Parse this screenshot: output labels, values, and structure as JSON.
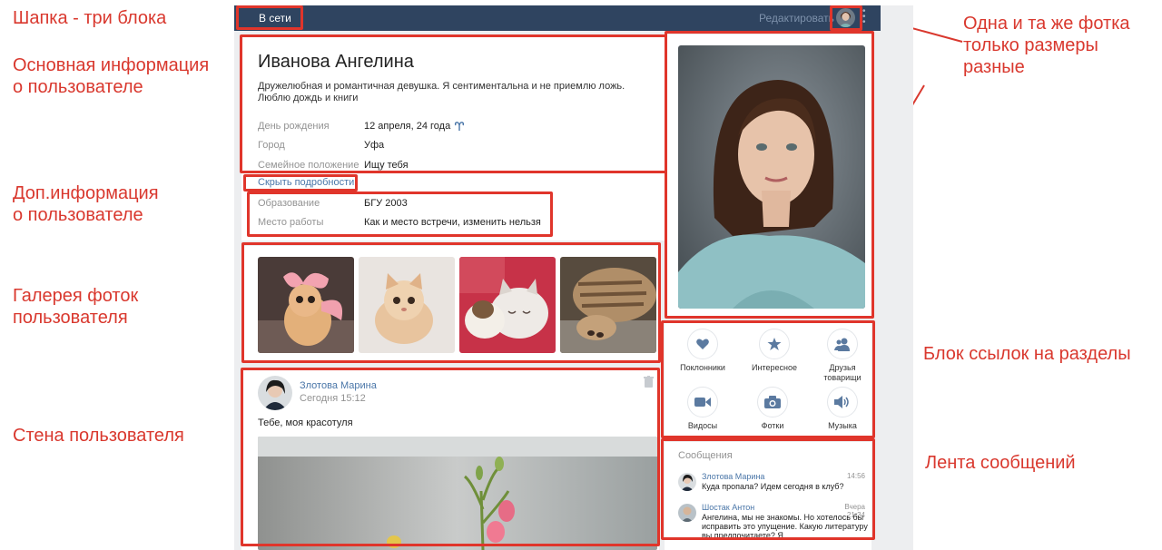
{
  "header": {
    "status_label": "В сети",
    "edit_label": "Редактировать"
  },
  "profile": {
    "name": "Иванова Ангелина",
    "status": "Дружелюбная и романтичная девушка. Я сентиментальна и не приемлю ложь. Люблю дождь и книги",
    "fields": [
      {
        "label": "День рождения",
        "value": "12 апреля, 24 года"
      },
      {
        "label": "Город",
        "value": "Уфа"
      },
      {
        "label": "Семейное положение",
        "value": "Ищу тебя"
      }
    ],
    "toggle_details": "Скрыть подробности",
    "extra_fields": [
      {
        "label": "Образование",
        "value": "БГУ 2003"
      },
      {
        "label": "Место работы",
        "value": "Как и место встречи, изменить нельзя"
      }
    ],
    "zodiac_icon": "aries-icon"
  },
  "gallery": {
    "photos": [
      "cat-with-bow-photo",
      "fluffy-kitten-photo",
      "sleeping-kitten-photo",
      "cat-paw-photo"
    ]
  },
  "wall": {
    "post": {
      "author": "Злотова Марина",
      "time": "Сегодня 15:12",
      "text": "Тебе, моя красотуля"
    }
  },
  "sections": {
    "items": [
      {
        "label": "Поклонники",
        "icon": "heart-icon"
      },
      {
        "label": "Интересное",
        "icon": "star-icon"
      },
      {
        "label": "Друзья товарищи",
        "icon": "friends-icon"
      },
      {
        "label": "Видосы",
        "icon": "video-camera-icon"
      },
      {
        "label": "Фотки",
        "icon": "photo-camera-icon"
      },
      {
        "label": "Музыка",
        "icon": "speaker-icon"
      }
    ]
  },
  "messages": {
    "title": "Сообщения",
    "items": [
      {
        "author": "Злотова Марина",
        "time": "14:56",
        "text": "Куда пропала? Идем сегодня в клуб?"
      },
      {
        "author": "Шостак Антон",
        "time": "Вчера 21:34",
        "text": "Ангелина, мы не знакомы. Но хотелось бы исправить это упущение. Какую литературу вы предпочитаете? Я"
      }
    ]
  },
  "annotations": {
    "header": "Шапка - три блока",
    "main_info": "Основная информация\nо пользователе",
    "extra_info": "Доп.информация\nо пользователе",
    "gallery": "Галерея фоток\nпользователя",
    "wall": "Стена пользователя",
    "photo_note": "Одна и та же фотка\nтолько размеры\nразные",
    "links_block": "Блок ссылок на разделы",
    "messages_feed": "Лента сообщений"
  },
  "colors": {
    "accent": "#e0352b",
    "header_bg": "#2f4460",
    "link": "#4a76a8",
    "page_bg": "#edeef0"
  }
}
